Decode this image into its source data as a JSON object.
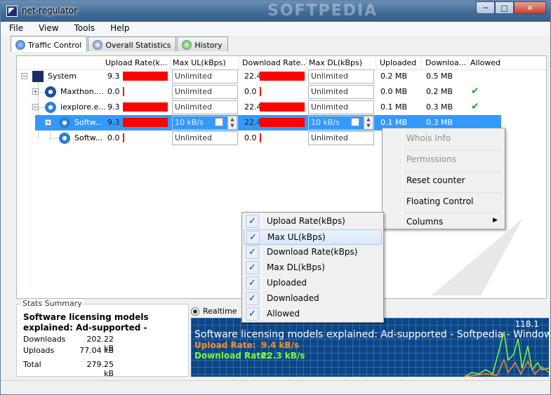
{
  "window": {
    "title": "net-regulator",
    "watermark": "SOFTPEDIA"
  },
  "menu": [
    "File",
    "View",
    "Tools",
    "Help"
  ],
  "tabs": [
    {
      "label": "Traffic Control",
      "active": true,
      "icon": "traffic-control-icon"
    },
    {
      "label": "Overall Statistics",
      "active": false,
      "icon": "statistics-icon"
    },
    {
      "label": "History",
      "active": false,
      "icon": "history-icon"
    }
  ],
  "columns": [
    "Upload Rate(k...",
    "Max UL(kBps)",
    "Download Rate...",
    "Max DL(kBps)",
    "Uploaded",
    "Downloa...",
    "Allowed"
  ],
  "rows": [
    {
      "name": "System",
      "ul_rate": "9.3",
      "max_ul": "Unlimited",
      "dl_rate": "22.4",
      "max_dl": "Unlimited",
      "uploaded": "0.2 MB",
      "downloaded": "0.5 MB",
      "allowed": false
    },
    {
      "name": "Maxthon....",
      "ul_rate": "0.0",
      "max_ul": "Unlimited",
      "dl_rate": "0.0",
      "max_dl": "Unlimited",
      "uploaded": "0.0 MB",
      "downloaded": "0.2 MB",
      "allowed": true
    },
    {
      "name": "iexplore.e...",
      "ul_rate": "9.3",
      "max_ul": "Unlimited",
      "dl_rate": "22.4",
      "max_dl": "Unlimited",
      "uploaded": "0.1 MB",
      "downloaded": "0.3 MB",
      "allowed": true
    },
    {
      "name": "Softw...",
      "ul_rate": "9.3",
      "max_ul": "10 kB/s",
      "dl_rate": "22.4",
      "max_dl": "10 kB/s",
      "uploaded": "0.1 MB",
      "downloaded": "0.3 MB",
      "allowed": false
    },
    {
      "name": "Softw...",
      "ul_rate": "0.0",
      "max_ul": "Unlimited",
      "dl_rate": "0.0",
      "max_dl": "Unlimited",
      "uploaded": "",
      "downloaded": "",
      "allowed": false
    }
  ],
  "context_menu": {
    "items": [
      {
        "label": "Whois Info",
        "enabled": false
      },
      {
        "label": "Permissions",
        "enabled": false
      },
      {
        "label": "Reset counter",
        "enabled": true
      },
      {
        "label": "Floating Control",
        "enabled": true
      },
      {
        "label": "Columns",
        "enabled": true,
        "submenu": true
      }
    ]
  },
  "columns_menu": {
    "items": [
      {
        "label": "Upload Rate(kBps)",
        "checked": true
      },
      {
        "label": "Max UL(kBps)",
        "checked": true
      },
      {
        "label": "Download Rate(kBps)",
        "checked": true
      },
      {
        "label": "Max DL(kBps)",
        "checked": true
      },
      {
        "label": "Uploaded",
        "checked": true
      },
      {
        "label": "Downloaded",
        "checked": true
      },
      {
        "label": "Allowed",
        "checked": true
      }
    ]
  },
  "stats": {
    "legend": "Stats Summary",
    "headline": "Software licensing models",
    "headline2": "explained: Ad-supported -",
    "downloads_label": "Downloads",
    "downloads": "202.22 kB",
    "uploads_label": "Uploads",
    "uploads": "77.04 kB",
    "total_label": "Total",
    "total": "279.25 kB"
  },
  "graph": {
    "mode": "Realtime",
    "top_value": "118.1",
    "title": "Software licensing models explained: Ad-supported - Softpedia - Window",
    "upload_label": "Upload Rate:",
    "upload_value": "9.4 kB/s",
    "download_label": "Download Rate:",
    "download_value": "22.3 kB/s",
    "colors": {
      "upload": "#ff8c1a",
      "download": "#7dff32",
      "background": "#0c4686"
    }
  }
}
